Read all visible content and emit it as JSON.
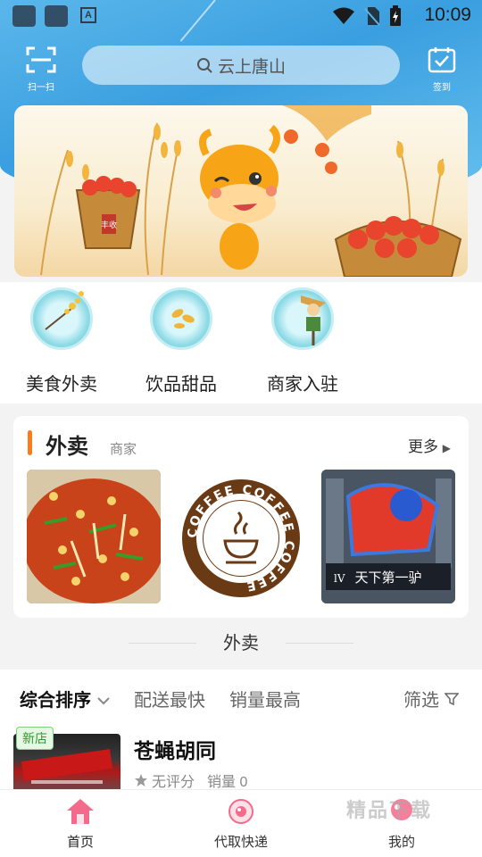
{
  "status_bar": {
    "time": "10:09",
    "app_icon_letter": "A"
  },
  "header": {
    "scan_label": "扫一扫",
    "search_placeholder": "云上唐山",
    "checkin_label": "签到"
  },
  "banner": {
    "basket_label": "丰收"
  },
  "categories": [
    {
      "label": "美食外卖",
      "icon": "flower-branch-icon"
    },
    {
      "label": "饮品甜品",
      "icon": "leaves-icon"
    },
    {
      "label": "商家入驻",
      "icon": "scarecrow-icon"
    }
  ],
  "takeout_card": {
    "title": "外卖",
    "subtitle": "商家",
    "more_label": "更多",
    "thumbnails": [
      {
        "kind": "food-dish"
      },
      {
        "kind": "coffee-logo",
        "ring_text": "COFFEE COFFEE COFFEE"
      },
      {
        "kind": "storefront",
        "sign_text": "天下第一驴",
        "sign_prefix": "lV"
      }
    ]
  },
  "section_divider": {
    "title": "外卖"
  },
  "sort_bar": {
    "options": [
      "综合排序",
      "配送最快",
      "销量最高"
    ],
    "filter_label": "筛选"
  },
  "store": {
    "badge": "新店",
    "name": "苍蝇胡同",
    "rating_label": "无评分",
    "sales_label": "销量 0"
  },
  "tab_bar": {
    "tabs": [
      {
        "label": "首页",
        "icon": "home-icon"
      },
      {
        "label": "代取快递",
        "icon": "parcel-icon"
      },
      {
        "label": "我的",
        "icon": "profile-icon"
      }
    ]
  },
  "watermark": "精品下载",
  "colors": {
    "accent": "#ff7a1a",
    "primary_blue": "#3a9fe0",
    "tab_active": "#f36a8a"
  }
}
